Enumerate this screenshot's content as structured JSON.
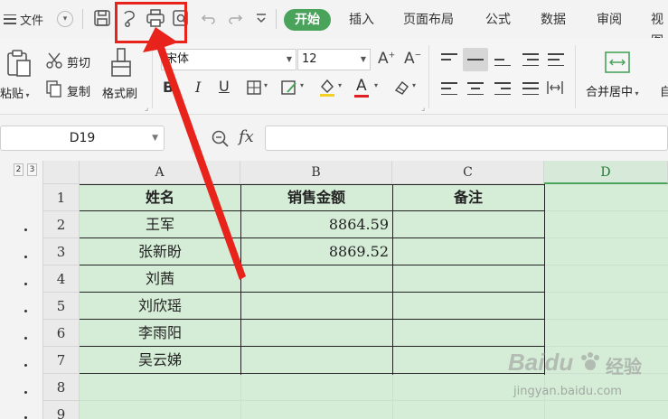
{
  "toolbar": {
    "file_label": "文件",
    "tabs": [
      "开始",
      "插入",
      "页面布局",
      "公式",
      "数据",
      "审阅",
      "视图"
    ]
  },
  "ribbon": {
    "paste_label": "粘贴",
    "cut_label": "剪切",
    "copy_label": "复制",
    "format_painter_label": "格式刷",
    "font_name": "宋体",
    "font_size": "12",
    "merge_center_label": "合并居中",
    "auto_wrap_label": "自"
  },
  "formula_bar": {
    "name_box": "D19",
    "fx_label": "fx",
    "formula": ""
  },
  "sheet": {
    "outline_levels": [
      "2",
      "3"
    ],
    "columns": [
      "A",
      "B",
      "C",
      "D"
    ],
    "selected_column": "D",
    "rows": [
      "1",
      "2",
      "3",
      "4",
      "5",
      "6",
      "7",
      "8",
      "9"
    ],
    "header": [
      "姓名",
      "销售金额",
      "备注"
    ],
    "data": [
      [
        "王军",
        "8864.59",
        ""
      ],
      [
        "张新盼",
        "8869.52",
        ""
      ],
      [
        "刘茜",
        "",
        ""
      ],
      [
        "刘欣瑶",
        "",
        ""
      ],
      [
        "李雨阳",
        "",
        ""
      ],
      [
        "吴云娣",
        "",
        ""
      ]
    ]
  },
  "watermark": {
    "brand": "Baidu",
    "brand_cn": "经验",
    "url": "jingyan.baidu.com"
  },
  "colors": {
    "accent": "#4aa35a",
    "selection_fill": "#d5ecd7",
    "annotation_red": "#e8231c"
  }
}
